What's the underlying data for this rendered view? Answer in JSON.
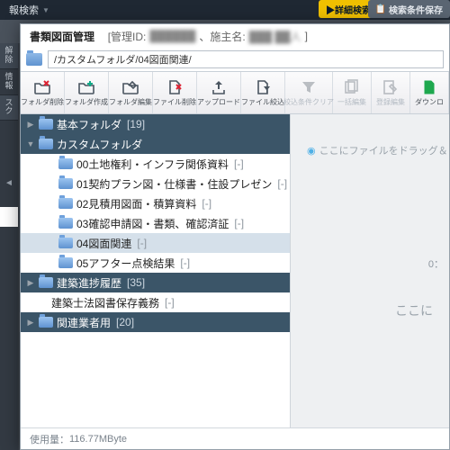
{
  "background": {
    "search_label": "報検索",
    "detail_search": "▶詳細検索",
    "save_cond": "検索条件保存",
    "left_cells": [
      "解除",
      "情報",
      "スク"
    ]
  },
  "dialog": {
    "title": "書類図面管理",
    "mgmt_label": "[管理ID:",
    "mgmt_id": "██████",
    "owner_label": "、施主名:",
    "owner_name": "███ ██人",
    "close_bracket": "]",
    "path_value": "/カスタムフォルダ/04図面関連/"
  },
  "toolbar": [
    {
      "icon": "folder-del",
      "label": "フォルダ削除",
      "disabled": false
    },
    {
      "icon": "folder-add",
      "label": "フォルダ作成",
      "disabled": false
    },
    {
      "icon": "folder-edit",
      "label": "フォルダ編集",
      "disabled": false
    },
    {
      "icon": "file-del",
      "label": "ファイル削除",
      "disabled": false
    },
    {
      "icon": "upload",
      "label": "アップロード",
      "disabled": false
    },
    {
      "icon": "file-filter",
      "label": "ファイル絞込",
      "disabled": false
    },
    {
      "icon": "filter-clear",
      "label": "絞込条件クリア",
      "disabled": true
    },
    {
      "icon": "batch-pub",
      "label": "一括編集",
      "disabled": true
    },
    {
      "icon": "batch-edit",
      "label": "登録編集",
      "disabled": true
    },
    {
      "icon": "download",
      "label": "ダウンロ",
      "disabled": false,
      "green": true
    }
  ],
  "tree": {
    "root1": {
      "label": "基本フォルダ",
      "count": "[19]"
    },
    "root2": {
      "label": "カスタムフォルダ"
    },
    "children": [
      {
        "label": "00土地権利・インフラ関係資料",
        "count": "[-]"
      },
      {
        "label": "01契約プラン図・仕様書・住設プレゼン",
        "count": "[-]"
      },
      {
        "label": "02見積用図面・積算資料",
        "count": "[-]"
      },
      {
        "label": "03確認申請図・書類、確認済証",
        "count": "[-]"
      },
      {
        "label": "04図面関連",
        "count": "[-]",
        "selected": true
      },
      {
        "label": "05アフター点検結果",
        "count": "[-]"
      }
    ],
    "root3": {
      "label": "建築進捗履歴",
      "count": "[35]"
    },
    "root3b": {
      "label": "建築士法図書保存義務",
      "count": "[-]"
    },
    "root4": {
      "label": "関連業者用",
      "count": "[20]"
    }
  },
  "drop": {
    "hint": "ここにファイルをドラッグ＆ドロッ",
    "center": "ここに",
    "time": "0："
  },
  "footer": {
    "usage_label": "使用量：",
    "usage_value": "116.77MByte"
  }
}
